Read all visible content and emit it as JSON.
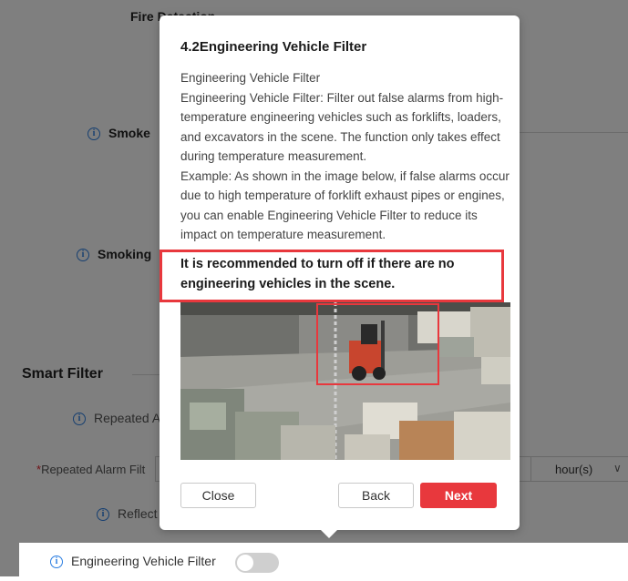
{
  "background": {
    "fire_detection_label": "Fire Detection",
    "smoke_label": "Smoke",
    "smoking_label": "Smoking",
    "smart_filter_title": "Smart Filter",
    "repeated_alarm_label": "Repeated A",
    "repeated_alarm_filter_label": "Repeated Alarm Filt",
    "repeated_alarm_unit": "hour(s)",
    "reflect_label": "Reflect",
    "engineering_vehicle_filter_label": "Engineering Vehicle Filter",
    "engineering_vehicle_filter_enabled": false
  },
  "popup": {
    "title": "4.2Engineering Vehicle Filter",
    "paragraphs": [
      "Engineering Vehicle Filter",
      "Engineering Vehicle Filter: Filter out false alarms from high-temperature engineering vehicles such as forklifts, loaders, and excavators in the scene. The function only takes effect during temperature measurement.",
      "Example: As shown in the image below, if false alarms occur due to high temperature of forklift exhaust pipes or engines, you can enable Engineering Vehicle Filter to reduce its impact on temperature measurement."
    ],
    "recommendation": "It is recommended to turn off if there are no engineering vehicles in the scene.",
    "buttons": {
      "close": "Close",
      "back": "Back",
      "next": "Next"
    }
  },
  "colors": {
    "accent_red": "#e8383d",
    "info_blue": "#2a7de1",
    "overlay": "rgba(0,0,0,0.5)"
  },
  "icons": {
    "info": "info-circle-icon",
    "chevron": "chevron-down-icon"
  }
}
